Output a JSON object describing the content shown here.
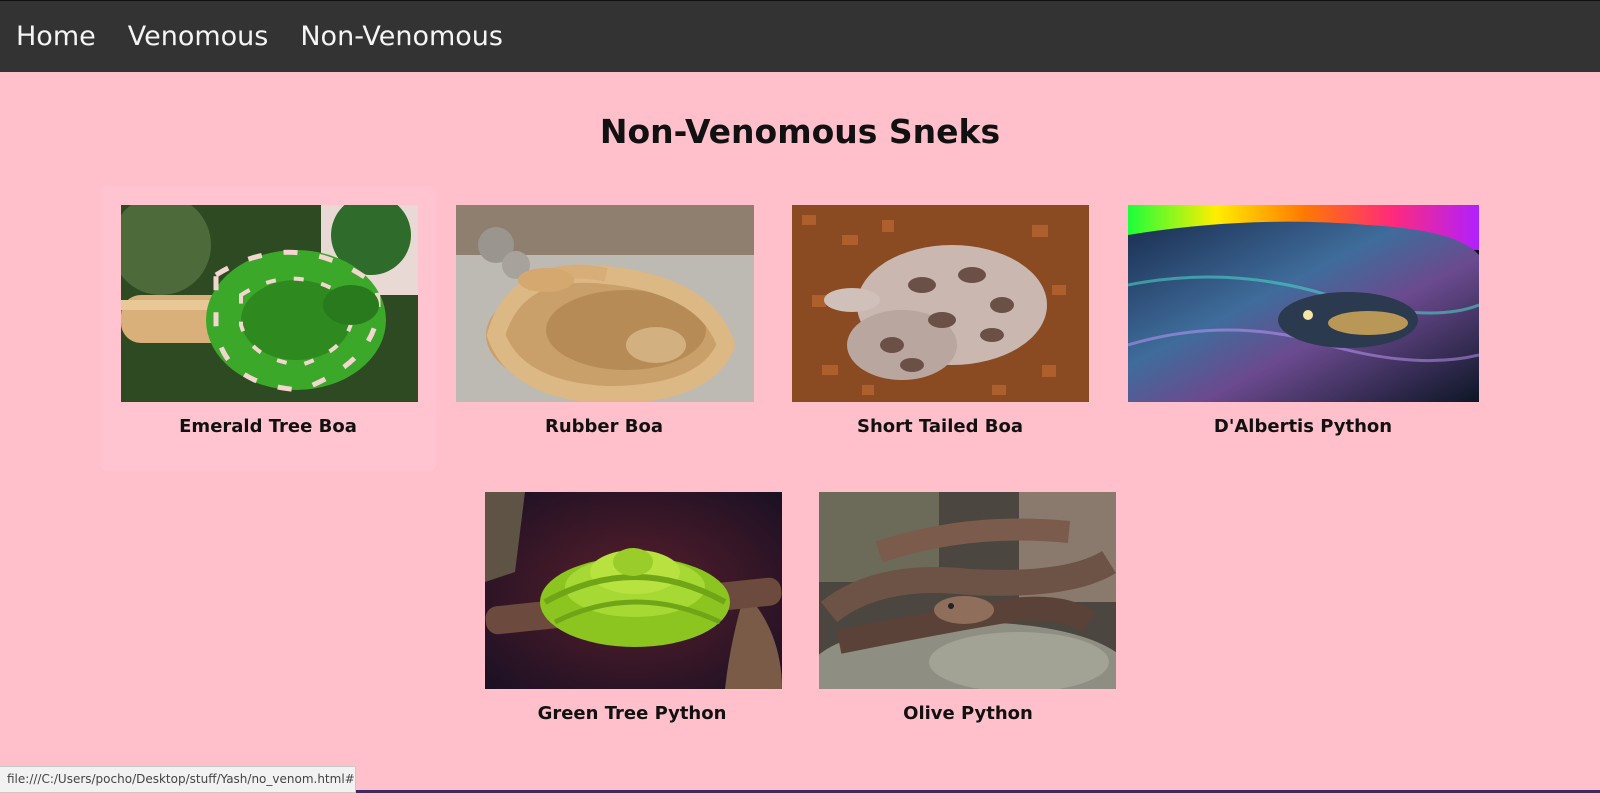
{
  "nav": {
    "items": [
      {
        "label": "Home"
      },
      {
        "label": "Venomous"
      },
      {
        "label": "Non-Venomous"
      }
    ]
  },
  "page": {
    "title": "Non-Venomous Sneks"
  },
  "gallery": {
    "cards": [
      {
        "name": "Emerald Tree Boa"
      },
      {
        "name": "Rubber Boa"
      },
      {
        "name": "Short Tailed Boa"
      },
      {
        "name": "D'Albertis Python"
      },
      {
        "name": "Green Tree Python"
      },
      {
        "name": "Olive Python"
      }
    ]
  },
  "status": {
    "url": "file:///C:/Users/pocho/Desktop/stuff/Yash/no_venom.html#"
  },
  "colors": {
    "background": "#ffbfcb",
    "navbar": "#333333",
    "nav_text": "#f4f4f4"
  }
}
